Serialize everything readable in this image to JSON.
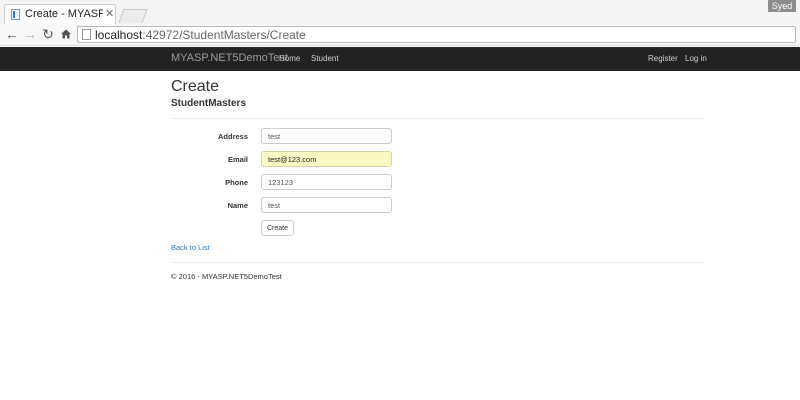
{
  "browser": {
    "tab_title": "Create - MYASP.NET",
    "tab_close": "✕",
    "profile_name": "Syed",
    "url_host": "localhost",
    "url_rest": ":42972/StudentMasters/Create",
    "icons": {
      "back": "back-arrow-icon",
      "forward": "forward-arrow-icon",
      "reload": "reload-icon",
      "home": "home-icon",
      "page": "page-icon"
    }
  },
  "navbar": {
    "brand": "MYASP.NET5DemoTest",
    "links": [
      "Home",
      "Student"
    ],
    "right_links": [
      "Register",
      "Log in"
    ],
    "background": "#222222"
  },
  "page": {
    "title": "Create",
    "subtitle": "StudentMasters",
    "fields": [
      {
        "label": "Address",
        "value": "test"
      },
      {
        "label": "Email",
        "value": "test@123.com"
      },
      {
        "label": "Phone",
        "value": "123123"
      },
      {
        "label": "Name",
        "value": "test"
      }
    ],
    "submit_label": "Create",
    "back_link": "Back to List",
    "footer": "© 2016 - MYASP.NET5DemoTest",
    "link_color": "#337ab7",
    "autofill_color": "#fbf9c3"
  }
}
